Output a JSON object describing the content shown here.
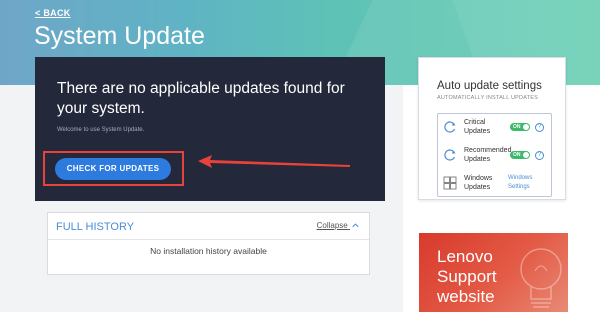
{
  "header": {
    "back_label": "< BACK",
    "title": "System Update"
  },
  "main": {
    "message": "There are no applicable updates found for your system.",
    "welcome": "Welcome to use System Update.",
    "check_button": "CHECK FOR UPDATES"
  },
  "history": {
    "title": "FULL HISTORY",
    "collapse_label": "Collapse",
    "empty_text": "No installation history available"
  },
  "auto_update": {
    "title": "Auto update settings",
    "subtitle": "AUTOMATICALLY INSTALL UPDATES",
    "rows": [
      {
        "label_line1": "Critical",
        "label_line2": "Updates",
        "toggle": "ON",
        "icon": "refresh-icon"
      },
      {
        "label_line1": "Recommended",
        "label_line2": "Updates",
        "toggle": "ON",
        "icon": "refresh-icon"
      },
      {
        "label_line1": "Windows",
        "label_line2": "Updates",
        "link_line1": "Windows",
        "link_line2": "Settings",
        "icon": "windows-icon"
      }
    ],
    "help_glyph": "?"
  },
  "support": {
    "line1": "Lenovo",
    "line2": "Support",
    "line3": "website"
  },
  "colors": {
    "accent_blue": "#2e7be0",
    "panel_dark": "#23283b",
    "toggle_green": "#3cb96b",
    "highlight_red": "#e8423a",
    "support_red": "#d83a2c"
  }
}
